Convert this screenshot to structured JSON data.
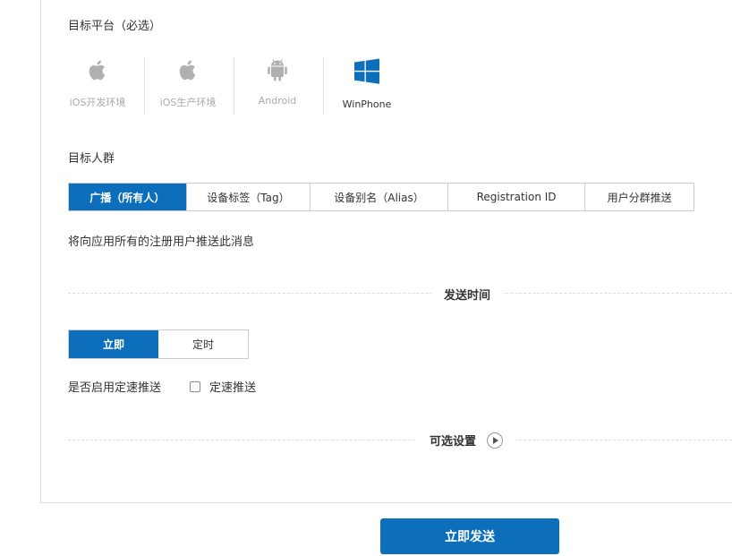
{
  "target_platform": {
    "label": "目标平台（必选）",
    "items": [
      {
        "name": "iOS开发环境",
        "icon": "apple-icon",
        "selected": false
      },
      {
        "name": "iOS生产环境",
        "icon": "apple-icon",
        "selected": false
      },
      {
        "name": "Android",
        "icon": "android-icon",
        "selected": false
      },
      {
        "name": "WinPhone",
        "icon": "windows-icon",
        "selected": true
      }
    ]
  },
  "audience": {
    "label": "目标人群",
    "tabs": [
      {
        "label": "广播（所有人）",
        "active": true
      },
      {
        "label": "设备标签（Tag）",
        "active": false
      },
      {
        "label": "设备别名（Alias）",
        "active": false
      },
      {
        "label": "Registration ID",
        "active": false
      },
      {
        "label": "用户分群推送",
        "active": false
      }
    ],
    "description": "将向应用所有的注册用户推送此消息"
  },
  "send_time": {
    "title": "发送时间",
    "options": [
      {
        "label": "立即",
        "active": true
      },
      {
        "label": "定时",
        "active": false
      }
    ],
    "speed_question": "是否启用定速推送",
    "speed_checkbox_label": "定速推送",
    "speed_checked": false
  },
  "optional": {
    "title": "可选设置"
  },
  "submit": {
    "label": "立即发送"
  },
  "colors": {
    "accent": "#0d6fbb",
    "inactive_icon": "#b0b0b0"
  }
}
